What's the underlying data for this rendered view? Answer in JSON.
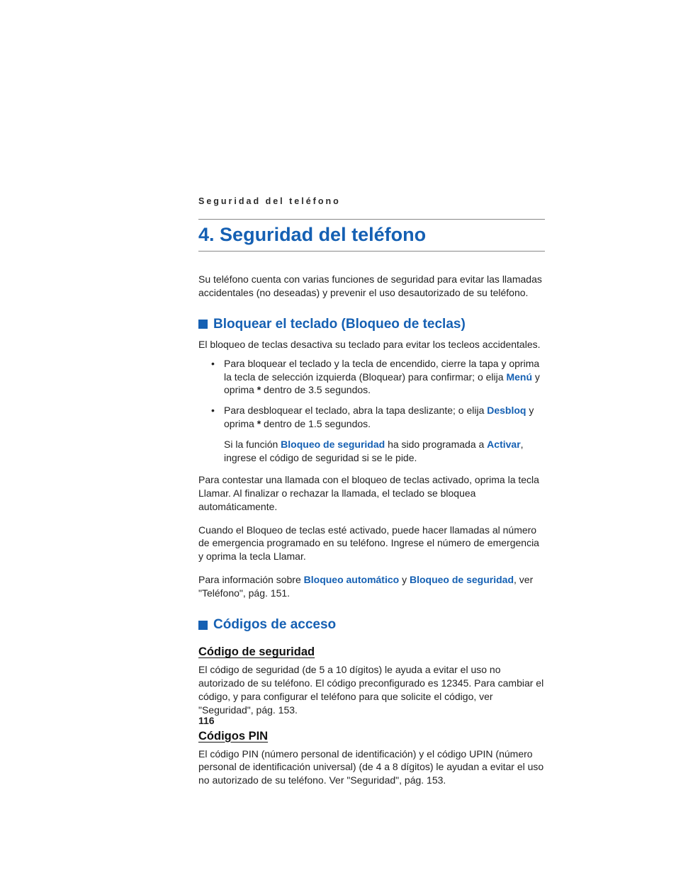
{
  "running_header": "Seguridad del teléfono",
  "chapter": {
    "number": "4.",
    "title": "Seguridad del teléfono"
  },
  "intro": "Su teléfono cuenta con varias funciones de seguridad para evitar las llamadas accidentales (no deseadas) y prevenir el uso desautorizado de su teléfono.",
  "section1": {
    "title": "Bloquear el teclado (Bloqueo de teclas)",
    "lead": "El bloqueo de teclas desactiva su teclado para evitar los tecleos accidentales.",
    "bullet1_a": "Para bloquear el teclado y la tecla de encendido, cierre la tapa y oprima la tecla de selección izquierda (Bloquear) para confirmar; o elija ",
    "bullet1_kw": "Menú",
    "bullet1_b": " y oprima ",
    "bullet1_c": "*",
    "bullet1_d": " dentro de 3.5 segundos.",
    "bullet2_a": "Para desbloquear el teclado, abra la tapa deslizante; o elija ",
    "bullet2_kw": "Desbloq",
    "bullet2_b": " y oprima ",
    "bullet2_c": "*",
    "bullet2_d": " dentro de 1.5 segundos.",
    "note_a": "Si la función ",
    "note_kw1": "Bloqueo de seguridad",
    "note_b": " ha sido programada a ",
    "note_kw2": "Activar",
    "note_c": ", ingrese el código de seguridad si se le pide.",
    "p1": "Para contestar una llamada con el bloqueo de teclas activado, oprima la tecla Llamar. Al finalizar o rechazar la llamada, el teclado se bloquea automáticamente.",
    "p2": "Cuando el Bloqueo de teclas esté activado, puede hacer llamadas al número de emergencia programado en su teléfono. Ingrese el número de emergencia y oprima la tecla Llamar.",
    "p3_a": "Para información sobre ",
    "p3_kw1": "Bloqueo automático",
    "p3_b": " y ",
    "p3_kw2": "Bloqueo de seguridad",
    "p3_c": ", ver \"Teléfono\", pág. 151."
  },
  "section2": {
    "title": "Códigos de acceso",
    "sub1": {
      "title": "Código de seguridad",
      "text": "El código de seguridad (de 5 a 10 dígitos) le ayuda a evitar el uso no autorizado de su teléfono. El código preconfigurado es 12345. Para cambiar el código, y para configurar el teléfono para que solicite el código, ver \"Seguridad\", pág. 153."
    },
    "sub2": {
      "title": "Códigos PIN",
      "text": "El código PIN (número personal de identificación) y el código UPIN (número personal de identificación universal) (de 4 a 8 dígitos) le ayudan a evitar el uso no autorizado de su teléfono. Ver \"Seguridad\", pág. 153."
    }
  },
  "page_number": "116"
}
